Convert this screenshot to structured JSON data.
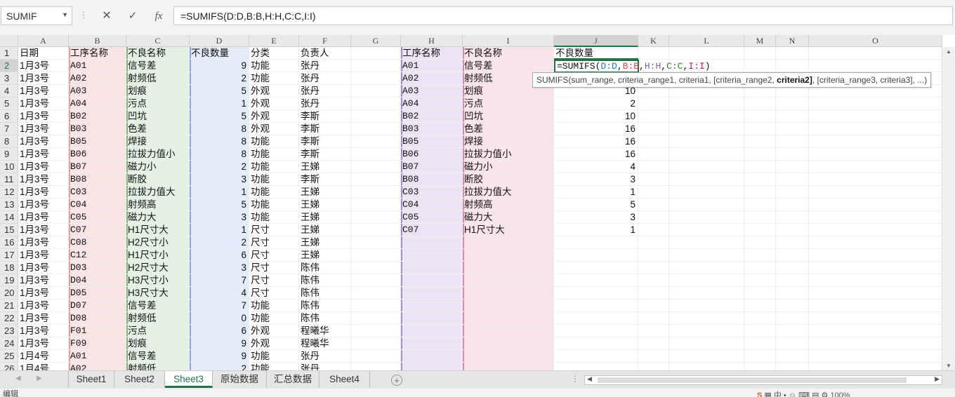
{
  "formula_bar": {
    "name_box": "SUMIF",
    "separator": "⋮",
    "cancel": "✕",
    "enter": "✓",
    "fx": "fx",
    "formula": "=SUMIFS(D:D,B:B,H:H,C:C,I:I)"
  },
  "columns": [
    "A",
    "B",
    "C",
    "D",
    "E",
    "F",
    "G",
    "H",
    "I",
    "J",
    "K",
    "L",
    "M",
    "N",
    "O"
  ],
  "rows": [
    [
      "日期",
      "工序名称",
      "不良名称",
      "不良数量",
      "分类",
      "负责人"
    ],
    [
      "1月3号",
      "A01",
      "信号差",
      "9",
      "功能",
      "张丹"
    ],
    [
      "1月3号",
      "A02",
      "射频低",
      "2",
      "功能",
      "张丹"
    ],
    [
      "1月3号",
      "A03",
      "划痕",
      "5",
      "外观",
      "张丹"
    ],
    [
      "1月3号",
      "A04",
      "污点",
      "1",
      "外观",
      "张丹"
    ],
    [
      "1月3号",
      "B02",
      "凹坑",
      "5",
      "外观",
      "李斯"
    ],
    [
      "1月3号",
      "B03",
      "色差",
      "8",
      "外观",
      "李斯"
    ],
    [
      "1月3号",
      "B05",
      "焊接",
      "8",
      "功能",
      "李斯"
    ],
    [
      "1月3号",
      "B06",
      "拉拔力值小",
      "8",
      "功能",
      "李斯"
    ],
    [
      "1月3号",
      "B07",
      "磁力小",
      "2",
      "功能",
      "王娣"
    ],
    [
      "1月3号",
      "B08",
      "断胶",
      "3",
      "功能",
      "李斯"
    ],
    [
      "1月3号",
      "C03",
      "拉拔力值大",
      "1",
      "功能",
      "王娣"
    ],
    [
      "1月3号",
      "C04",
      "射频高",
      "5",
      "功能",
      "王娣"
    ],
    [
      "1月3号",
      "C05",
      "磁力大",
      "3",
      "功能",
      "王娣"
    ],
    [
      "1月3号",
      "C07",
      "H1尺寸大",
      "1",
      "尺寸",
      "王娣"
    ],
    [
      "1月3号",
      "C08",
      "H2尺寸小",
      "2",
      "尺寸",
      "王娣"
    ],
    [
      "1月3号",
      "C12",
      "H1尺寸小",
      "6",
      "尺寸",
      "王娣"
    ],
    [
      "1月3号",
      "D03",
      "H2尺寸大",
      "3",
      "尺寸",
      "陈伟"
    ],
    [
      "1月3号",
      "D04",
      "H3尺寸小",
      "7",
      "尺寸",
      "陈伟"
    ],
    [
      "1月3号",
      "D05",
      "H3尺寸大",
      "4",
      "尺寸",
      "陈伟"
    ],
    [
      "1月3号",
      "D07",
      "信号差",
      "7",
      "功能",
      "陈伟"
    ],
    [
      "1月3号",
      "D08",
      "射频低",
      "0",
      "功能",
      "陈伟"
    ],
    [
      "1月3号",
      "F01",
      "污点",
      "6",
      "外观",
      "程曦华"
    ],
    [
      "1月3号",
      "F09",
      "划痕",
      "9",
      "外观",
      "程曦华"
    ],
    [
      "1月4号",
      "A01",
      "信号差",
      "9",
      "功能",
      "张丹"
    ],
    [
      "1月4号",
      "A02",
      "射频低",
      "2",
      "功能",
      "张丹"
    ]
  ],
  "summary": {
    "header": [
      "工序名称",
      "不良名称",
      "不良数量"
    ],
    "rows": [
      [
        "A01",
        "信号差",
        ""
      ],
      [
        "A02",
        "射频低",
        ""
      ],
      [
        "A03",
        "划痕",
        "10"
      ],
      [
        "A04",
        "污点",
        "2"
      ],
      [
        "B02",
        "凹坑",
        "10"
      ],
      [
        "B03",
        "色差",
        "16"
      ],
      [
        "B05",
        "焊接",
        "16"
      ],
      [
        "B06",
        "拉拔力值小",
        "16"
      ],
      [
        "B07",
        "磁力小",
        "4"
      ],
      [
        "B08",
        "断胶",
        "3"
      ],
      [
        "C03",
        "拉拔力值大",
        "1"
      ],
      [
        "C04",
        "射频高",
        "5"
      ],
      [
        "C05",
        "磁力大",
        "3"
      ],
      [
        "C07",
        "H1尺寸大",
        "1"
      ]
    ]
  },
  "editing": {
    "prefix": "=SUMIFS(",
    "ref_d": "D:D",
    "ref_b": "B:B",
    "ref_h": "H:H",
    "ref_c": "C:C",
    "ref_i": "I:I",
    "comma": ",",
    "suffix": ")"
  },
  "tooltip": {
    "before": "SUMIFS(sum_range, criteria_range1, criteria1, [criteria_range2, ",
    "bold": "criteria2]",
    "after": ", [criteria_range3, criteria3], ...)"
  },
  "tabs": [
    {
      "label": "Sheet1",
      "active": false
    },
    {
      "label": "Sheet2",
      "active": false
    },
    {
      "label": "Sheet3",
      "active": true
    },
    {
      "label": "原始数据",
      "active": false
    },
    {
      "label": "汇总数据",
      "active": false
    },
    {
      "label": "Sheet4",
      "active": false
    }
  ],
  "tab_nav": {
    "prev": "◀",
    "next": "▶",
    "add": "+",
    "split": "⋮"
  },
  "status": {
    "mode": "编辑",
    "ime": "S",
    "icons": "▦ 中 • ☺ ⌨ ▤ ⚙  100%"
  },
  "colors": {
    "accent": "#217346",
    "col_b": "#fbe4e4",
    "col_c": "#e3f1e3",
    "col_d": "#e3ecf8",
    "col_h": "#ece3f4",
    "col_i": "#f9e3ec"
  }
}
